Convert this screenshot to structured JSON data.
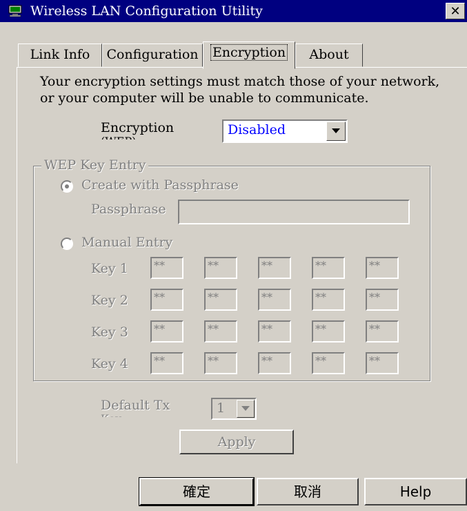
{
  "window": {
    "title": "Wireless LAN Configuration Utility",
    "close_glyph": "✕"
  },
  "tabs": [
    {
      "label": "Link Info",
      "active": false
    },
    {
      "label": "Configuration",
      "active": false
    },
    {
      "label": "Encryption",
      "active": true
    },
    {
      "label": "About",
      "active": false
    }
  ],
  "intro": {
    "line1": "Your encryption settings must match those of your network,",
    "line2": "or your computer will be unable to communicate."
  },
  "encryption": {
    "label": "Encryption (WEP)",
    "label_line1": "Encryption",
    "label_line2": "(WEP)",
    "selected": "Disabled"
  },
  "wep": {
    "group_title": "WEP Key Entry",
    "create_label": "Create with Passphrase",
    "passphrase_label": "Passphrase",
    "passphrase_value": "",
    "manual_label": "Manual Entry",
    "keys": [
      {
        "label": "Key 1",
        "values": [
          "**",
          "**",
          "**",
          "**",
          "**"
        ]
      },
      {
        "label": "Key 2",
        "values": [
          "**",
          "**",
          "**",
          "**",
          "**"
        ]
      },
      {
        "label": "Key 3",
        "values": [
          "**",
          "**",
          "**",
          "**",
          "**"
        ]
      },
      {
        "label": "Key 4",
        "values": [
          "**",
          "**",
          "**",
          "**",
          "**"
        ]
      }
    ]
  },
  "default_tx": {
    "label": "Default Tx Key",
    "label_line1": "Default Tx",
    "label_line2": "Key",
    "selected": "1"
  },
  "apply_label": "Apply",
  "footer": {
    "ok_label": "確定",
    "cancel_label": "取消",
    "help_label": "Help"
  },
  "colors": {
    "titlebar": "#000080",
    "face": "#d4d0c8",
    "disabled_text": "#808080",
    "combo_value": "#0000ff"
  },
  "icons": {
    "app": "network-computer-icon",
    "close": "close-icon",
    "dropdown": "chevron-down-icon"
  }
}
